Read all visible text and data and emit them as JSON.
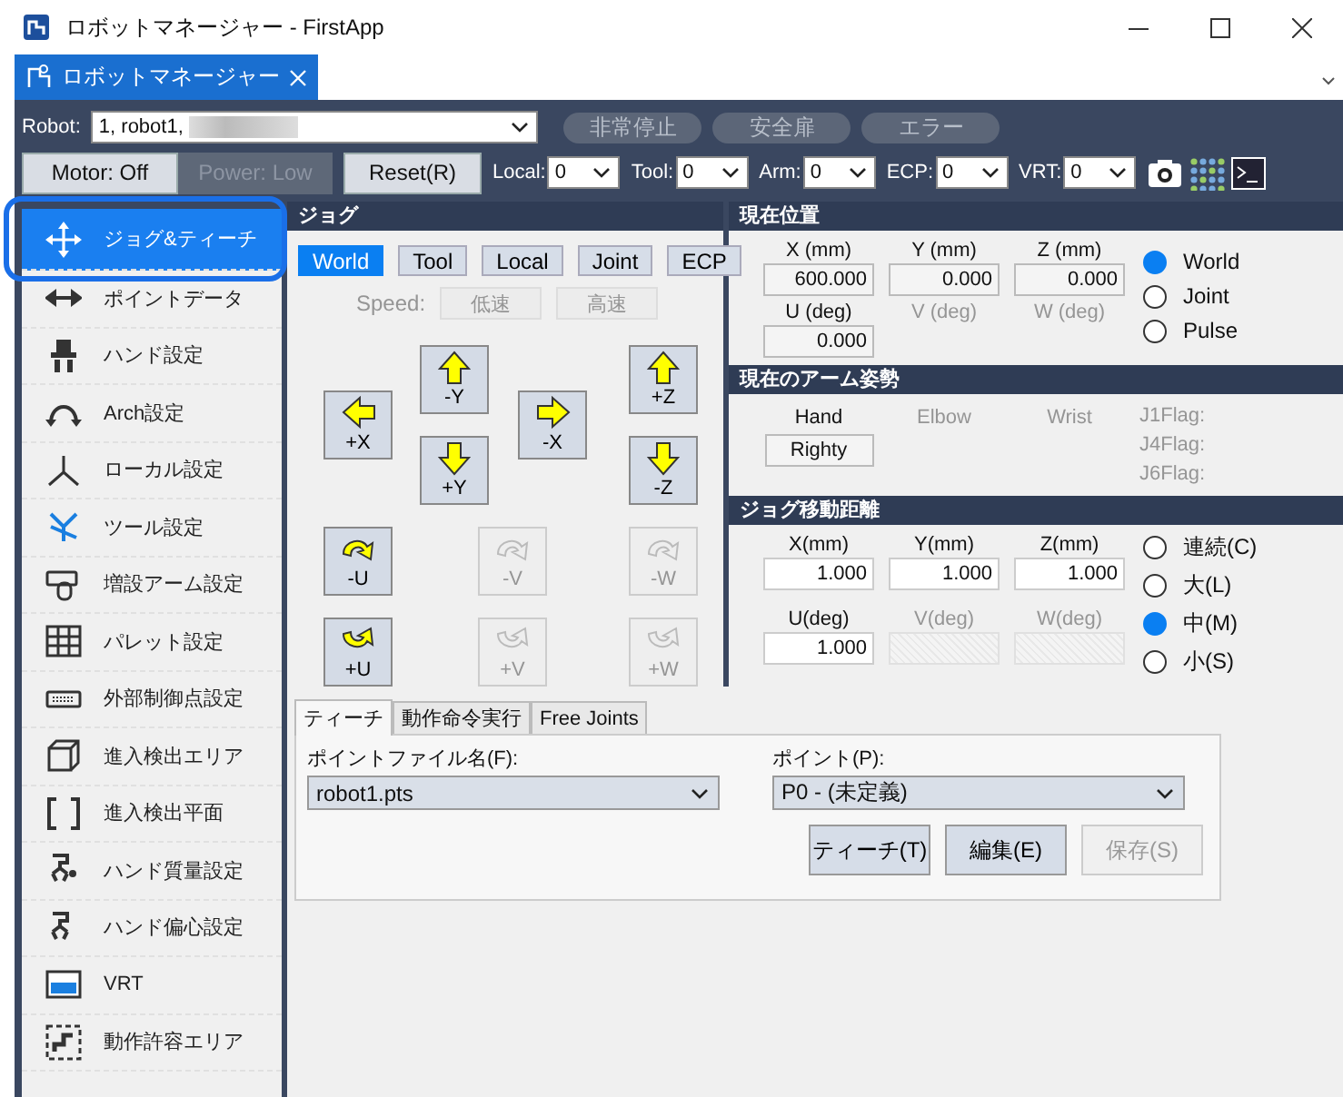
{
  "window": {
    "title": "ロボットマネージャー - FirstApp"
  },
  "doc_tab": {
    "label": "ロボットマネージャー",
    "selected": true
  },
  "toolbar": {
    "robot": {
      "label": "Robot:",
      "value": "1, robot1,"
    },
    "indicators": [
      {
        "label": "非常停止",
        "on": false
      },
      {
        "label": "安全扉",
        "on": false
      },
      {
        "label": "エラー",
        "on": false
      }
    ],
    "buttons": [
      {
        "label": "Motor: Off",
        "disabled": false
      },
      {
        "label": "Power: Low",
        "disabled": true
      },
      {
        "label": "Reset(R)",
        "disabled": false
      }
    ],
    "selectors": [
      {
        "label": "Local:",
        "value": "0"
      },
      {
        "label": "Tool:",
        "value": "0"
      },
      {
        "label": "Arm:",
        "value": "0"
      },
      {
        "label": "ECP:",
        "value": "0"
      },
      {
        "label": "VRT:",
        "value": "0"
      }
    ]
  },
  "sidebar": {
    "items": [
      {
        "label": "ジョグ&ティーチ",
        "kind": "jog",
        "selected": true
      },
      {
        "label": "ポイントデータ",
        "kind": "points",
        "selected": false
      },
      {
        "label": "ハンド設定",
        "kind": "hand",
        "selected": false
      },
      {
        "label": "Arch設定",
        "kind": "arch",
        "selected": false
      },
      {
        "label": "ローカル設定",
        "kind": "local",
        "selected": false
      },
      {
        "label": "ツール設定",
        "kind": "tool",
        "selected": false
      },
      {
        "label": "増設アーム設定",
        "kind": "arm",
        "selected": false
      },
      {
        "label": "パレット設定",
        "kind": "pallet",
        "selected": false
      },
      {
        "label": "外部制御点設定",
        "kind": "external",
        "selected": false
      },
      {
        "label": "進入検出エリア",
        "kind": "area",
        "selected": false
      },
      {
        "label": "進入検出平面",
        "kind": "plane",
        "selected": false
      },
      {
        "label": "ハンド質量設定",
        "kind": "mass",
        "selected": false
      },
      {
        "label": "ハンド偏心設定",
        "kind": "offset",
        "selected": false
      },
      {
        "label": "VRT",
        "kind": "vrt",
        "selected": false
      },
      {
        "label": "動作許容エリア",
        "kind": "motion",
        "selected": false
      }
    ]
  },
  "jog": {
    "title": "ジョグ",
    "modes": [
      {
        "label": "World",
        "selected": true
      },
      {
        "label": "Tool",
        "selected": false
      },
      {
        "label": "Local",
        "selected": false
      },
      {
        "label": "Joint",
        "selected": false
      },
      {
        "label": "ECP",
        "selected": false
      }
    ],
    "speed": {
      "label": "Speed:",
      "disabled": true,
      "buttons": [
        {
          "label": "低速",
          "disabled": true
        },
        {
          "label": "高速",
          "disabled": true
        }
      ]
    },
    "buttons": [
      {
        "label": "-Y",
        "kind": "up",
        "disabled": false
      },
      {
        "label": "+X",
        "kind": "left",
        "disabled": false
      },
      {
        "label": "+Y",
        "kind": "down",
        "disabled": false
      },
      {
        "label": "-X",
        "kind": "right",
        "disabled": false
      },
      {
        "label": "+Z",
        "kind": "up",
        "disabled": false
      },
      {
        "label": "-Z",
        "kind": "down",
        "disabled": false
      }
    ],
    "rotate_buttons": [
      {
        "label": "-U",
        "kind": "cw",
        "disabled": false
      },
      {
        "label": "-V",
        "kind": "cw",
        "disabled": true
      },
      {
        "label": "-W",
        "kind": "cw",
        "disabled": true
      },
      {
        "label": "+U",
        "kind": "ccw",
        "disabled": false
      },
      {
        "label": "+V",
        "kind": "ccw",
        "disabled": true
      },
      {
        "label": "+W",
        "kind": "ccw",
        "disabled": true
      }
    ]
  },
  "current_position": {
    "title": "現在位置",
    "fields": [
      {
        "label": "X (mm)",
        "value": "600.000",
        "disabled": false
      },
      {
        "label": "Y (mm)",
        "value": "0.000",
        "disabled": false
      },
      {
        "label": "Z (mm)",
        "value": "0.000",
        "disabled": false
      },
      {
        "label": "U (deg)",
        "value": "0.000",
        "disabled": false
      },
      {
        "label": "V (deg)",
        "disabled": true
      },
      {
        "label": "W (deg)",
        "disabled": true
      }
    ],
    "modes": [
      {
        "label": "World",
        "selected": true
      },
      {
        "label": "Joint",
        "selected": false
      },
      {
        "label": "Pulse",
        "selected": false
      }
    ]
  },
  "arm_pose": {
    "title": "現在のアーム姿勢",
    "items": [
      {
        "label": "Hand",
        "value": "Righty",
        "disabled": false
      },
      {
        "label": "Elbow",
        "disabled": true
      },
      {
        "label": "Wrist",
        "disabled": true
      }
    ],
    "flags": [
      {
        "label": "J1Flag:",
        "disabled": true
      },
      {
        "label": "J4Flag:",
        "disabled": true
      },
      {
        "label": "J6Flag:",
        "disabled": true
      }
    ]
  },
  "jog_distance": {
    "title": "ジョグ移動距離",
    "fields": [
      {
        "label": "X(mm)",
        "value": "1.000",
        "disabled": false
      },
      {
        "label": "Y(mm)",
        "value": "1.000",
        "disabled": false
      },
      {
        "label": "Z(mm)",
        "value": "1.000",
        "disabled": false
      },
      {
        "label": "U(deg)",
        "value": "1.000",
        "disabled": false
      },
      {
        "label": "V(deg)",
        "disabled": true
      },
      {
        "label": "W(deg)",
        "disabled": true
      }
    ],
    "modes": [
      {
        "label": "連続(C)",
        "selected": false
      },
      {
        "label": "大(L)",
        "selected": false
      },
      {
        "label": "中(M)",
        "selected": true
      },
      {
        "label": "小(S)",
        "selected": false
      }
    ]
  },
  "teach": {
    "tabs": [
      {
        "label": "ティーチ",
        "selected": true
      },
      {
        "label": "動作命令実行",
        "selected": false
      },
      {
        "label": "Free Joints",
        "selected": false
      }
    ],
    "file": {
      "label": "ポイントファイル名(F):",
      "value": "robot1.pts"
    },
    "point": {
      "label": "ポイント(P):",
      "value": "P0 - (未定義)"
    },
    "buttons": [
      {
        "label": "ティーチ(T)",
        "disabled": false
      },
      {
        "label": "編集(E)",
        "disabled": false
      },
      {
        "label": "保存(S)",
        "disabled": true
      }
    ]
  }
}
